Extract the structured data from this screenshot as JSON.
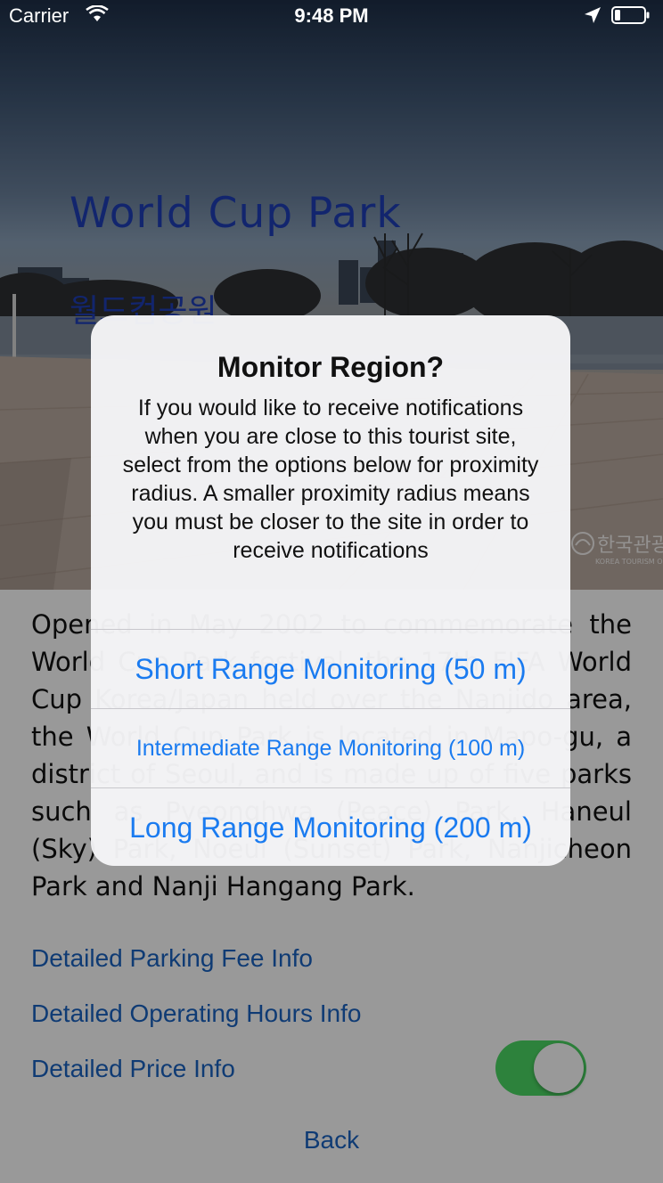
{
  "status_bar": {
    "carrier": "Carrier",
    "time": "9:48 PM"
  },
  "hero": {
    "title": "World Cup Park",
    "korean_title": "월드컵공원",
    "watermark": "한국관광",
    "watermark_sub": "KOREA TOURISM ORGANIZATION"
  },
  "content": {
    "description": "Opened in May 2002 to commemorate the World Cup Park festival, the 17th FIFA World Cup Korea/Japan held over the Nanjido area, the World Cup Park is located in Mapo-gu, a district of Seoul, and is made up of five parks such as Pyeonghwa (Peace) Park, Haneul (Sky) Park, Noeul (Sunset) Park, Nanjicheon Park and Nanji Hangang Park.",
    "links": {
      "parking": "Detailed Parking Fee Info",
      "hours": "Detailed Operating Hours Info",
      "price": "Detailed Price Info"
    },
    "price_toggle_on": true,
    "back": "Back"
  },
  "alert": {
    "title": "Monitor Region?",
    "message": "If you would like to receive notifications when you are close to this tourist site, select from the options below for proximity radius. A smaller proximity radius means you must be closer to the site in order to receive notifications",
    "actions": {
      "short": "Short Range Monitoring (50 m)",
      "intermediate": "Intermediate Range Monitoring (100 m)",
      "long": "Long Range Monitoring (200 m)"
    }
  },
  "colors": {
    "link": "#1a63c2",
    "alert_action": "#1a7bf0",
    "toggle_on": "#4cd964",
    "hero_title": "#1f3fb8"
  },
  "icons": [
    "wifi-icon",
    "location-arrow-icon",
    "battery-icon"
  ]
}
